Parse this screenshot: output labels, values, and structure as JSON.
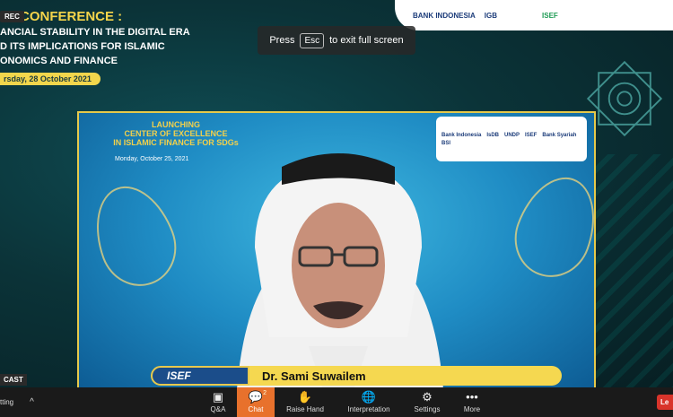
{
  "recording": {
    "rec_label": "REC",
    "cast_label": "CAST"
  },
  "fullscreen_hint": {
    "prefix": "Press",
    "key": "Esc",
    "suffix": "to exit full screen"
  },
  "conference": {
    "title": "CONFERENCE :",
    "subtitle_lines": [
      "ANCIAL STABILITY IN THE DIGITAL ERA",
      "D ITS IMPLICATIONS FOR ISLAMIC",
      "ONOMICS AND FINANCE"
    ],
    "date": "rsday, 28 October 2021"
  },
  "top_logos": {
    "bank": "BANK INDONESIA",
    "igb": "IGB",
    "isef": "ISEF"
  },
  "video": {
    "title_lines": [
      "LAUNCHING",
      "CENTER OF EXCELLENCE",
      "IN ISLAMIC FINANCE FOR SDGs"
    ],
    "date": "Monday, October 25, 2021",
    "partner_logos": [
      "Bank Indonesia",
      "IsDB",
      "UNDP",
      "ISEF",
      "Bank Syariah",
      "BSI"
    ],
    "event_logo": "ISEF",
    "speaker_name": "Dr. Sami Suwailem"
  },
  "toolbar": {
    "left_label": "tting",
    "qa_label": "Q&A",
    "chat_label": "Chat",
    "chat_badge": "2",
    "raise_hand_label": "Raise Hand",
    "interpretation_label": "Interpretation",
    "settings_label": "Settings",
    "more_label": "More",
    "leave_label": "Le",
    "accent_color": "#e8712c"
  }
}
